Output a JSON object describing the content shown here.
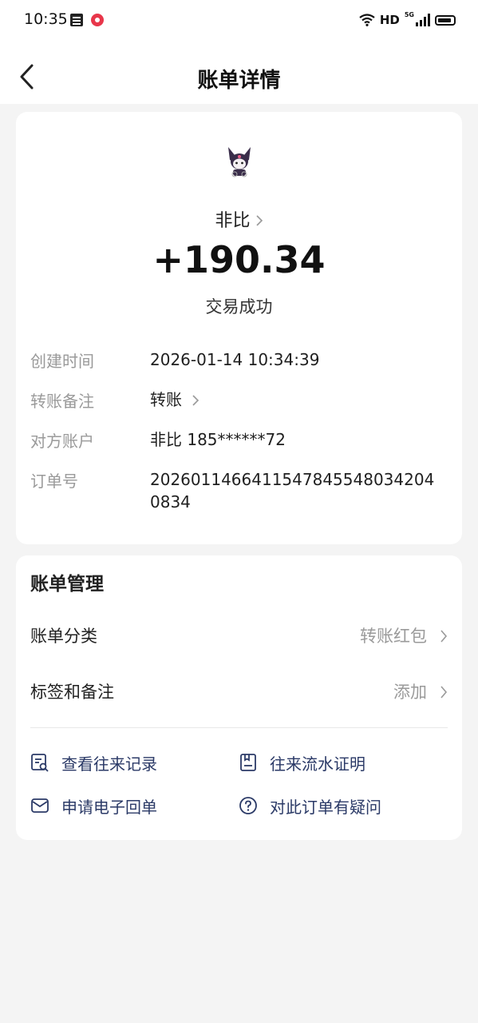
{
  "status_bar": {
    "time": "10:35",
    "hd": "HD",
    "network": "5G"
  },
  "nav": {
    "title": "账单详情"
  },
  "summary": {
    "payee": "非比",
    "amount": "+190.34",
    "status": "交易成功"
  },
  "details": [
    {
      "label": "创建时间",
      "value": "2026-01-14 10:34:39"
    },
    {
      "label": "转账备注",
      "value": "转账"
    },
    {
      "label": "对方账户",
      "value": "非比 185******72"
    },
    {
      "label": "订单号",
      "value": "2026011466411547845548034204​0834"
    }
  ],
  "management": {
    "title": "账单管理",
    "rows": [
      {
        "label": "账单分类",
        "value": "转账红包"
      },
      {
        "label": "标签和备注",
        "value": "添加"
      }
    ],
    "actions": [
      {
        "label": "查看往来记录",
        "icon": "records-icon"
      },
      {
        "label": "往来流水证明",
        "icon": "statement-icon"
      },
      {
        "label": "申请电子回单",
        "icon": "mail-icon"
      },
      {
        "label": "对此订单有疑问",
        "icon": "question-icon"
      }
    ]
  },
  "colors": {
    "accent": "#2b3a67",
    "muted": "#9a9a9a",
    "background": "#f4f4f4"
  }
}
